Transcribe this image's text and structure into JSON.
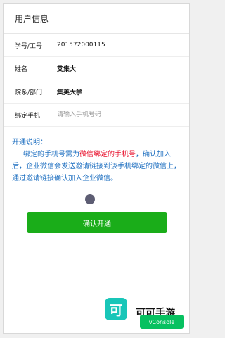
{
  "header": {
    "title": "用户信息"
  },
  "rows": [
    {
      "label": "学号/工号",
      "value": "201572000115"
    },
    {
      "label": "姓名",
      "value": "艾集大"
    },
    {
      "label": "院系/部门",
      "value": "集美大学"
    },
    {
      "label": "绑定手机",
      "placeholder": "请输入手机号码"
    }
  ],
  "notice": {
    "title": "开通说明：",
    "body_prefix": "绑定的手机号需为",
    "body_highlight": "微信绑定的手机号",
    "body_suffix": "，确认加入后，企业微信会发送邀请链接到该手机绑定的微信上，通过邀请链接确认加入企业微信。"
  },
  "confirm_button": {
    "label": "确认开通"
  },
  "watermark": {
    "logo": "可",
    "text": "可可手游"
  },
  "vconsole": {
    "label": "vConsole"
  },
  "colors": {
    "accent_green": "#1aad19",
    "notice_blue": "#1e6fc0",
    "highlight_red": "#e8112d",
    "vconsole_green": "#07c160"
  }
}
